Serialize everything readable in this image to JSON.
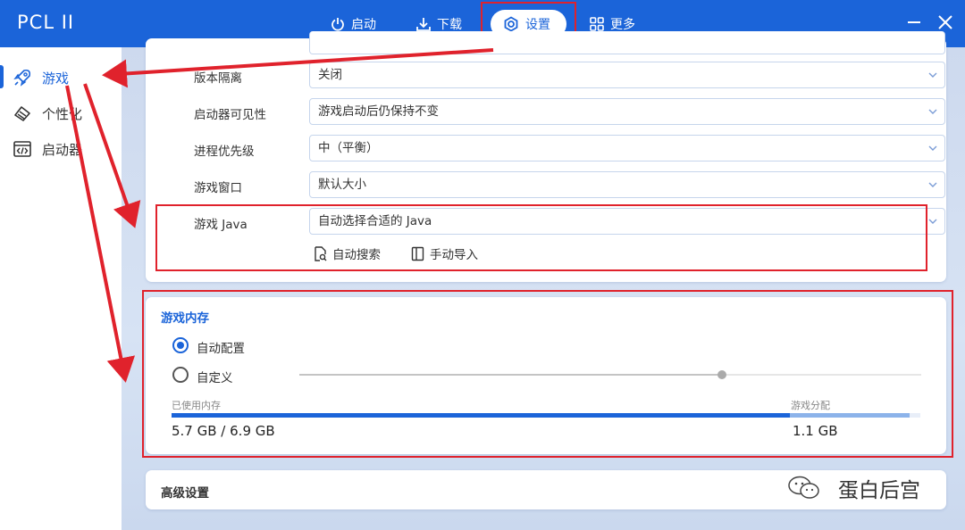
{
  "app": {
    "title": "PCL II"
  },
  "nav": {
    "launch": "启动",
    "download": "下载",
    "settings": "设置",
    "more": "更多"
  },
  "sidebar": {
    "items": [
      {
        "label": "游戏",
        "icon": "rocket-icon"
      },
      {
        "label": "个性化",
        "icon": "brush-icon"
      },
      {
        "label": "启动器",
        "icon": "code-window-icon"
      }
    ]
  },
  "settings": {
    "rows": [
      {
        "label": "版本隔离",
        "value": "关闭"
      },
      {
        "label": "启动器可见性",
        "value": "游戏启动后仍保持不变"
      },
      {
        "label": "进程优先级",
        "value": "中（平衡）"
      },
      {
        "label": "游戏窗口",
        "value": "默认大小"
      },
      {
        "label": "游戏 Java",
        "value": "自动选择合适的 Java"
      }
    ],
    "java_actions": {
      "auto_search": "自动搜索",
      "manual_import": "手动导入"
    }
  },
  "memory": {
    "title": "游戏内存",
    "auto_label": "自动配置",
    "custom_label": "自定义",
    "auto_selected": true,
    "slider_fraction": 0.68,
    "used_label": "已使用内存",
    "used_value": "5.7 GB / 6.9 GB",
    "game_label": "游戏分配",
    "game_value": "1.1 GB",
    "used_fraction": 0.826,
    "game_fraction": 0.16
  },
  "advanced": {
    "title": "高级设置"
  },
  "watermark": {
    "text": "蛋白后宫"
  },
  "colors": {
    "accent": "#1b64d9",
    "highlight": "#e0222c"
  }
}
